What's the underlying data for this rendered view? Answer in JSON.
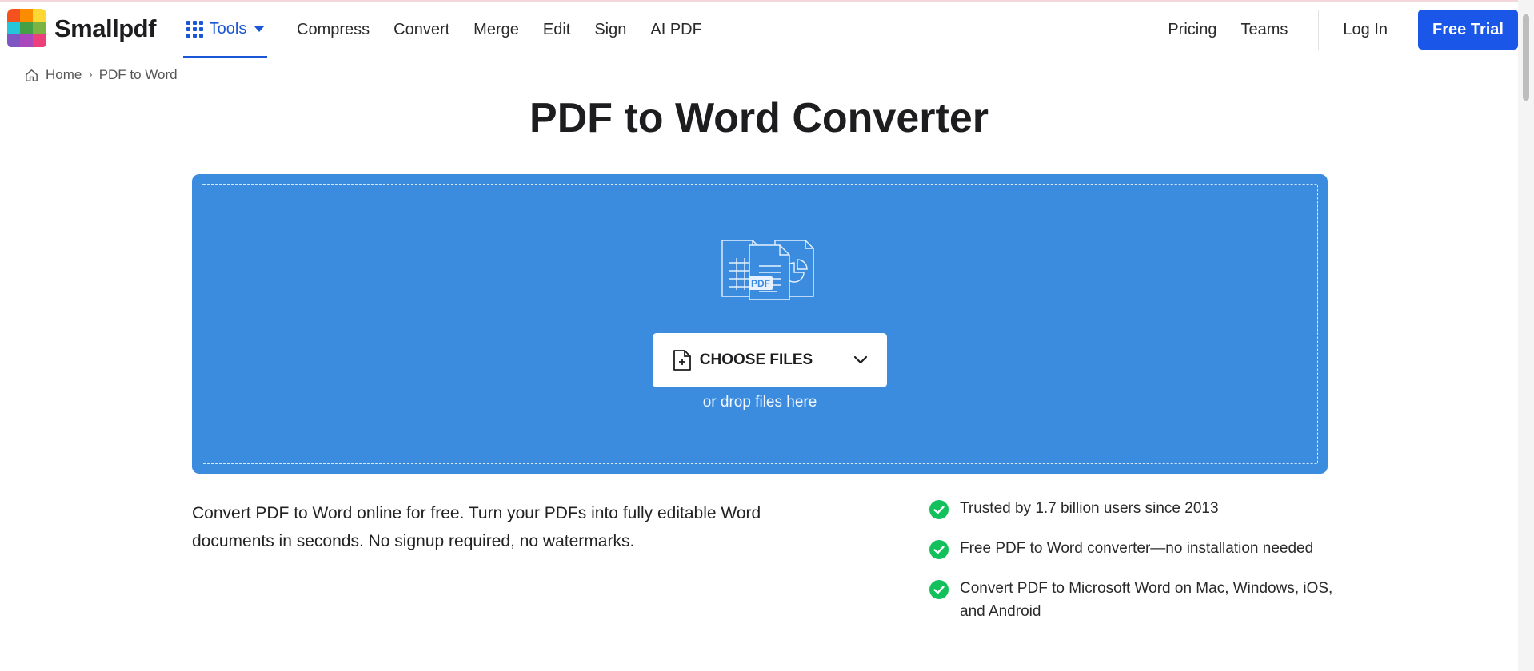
{
  "brand": {
    "name": "Smallpdf",
    "logo_colors": [
      "#f4511e",
      "#fb8c00",
      "#fdd835",
      "#26c6da",
      "#43a047",
      "#7cb342",
      "#7e57c2",
      "#ab47bc",
      "#ec407a"
    ]
  },
  "nav": {
    "tools_label": "Tools",
    "links": [
      "Compress",
      "Convert",
      "Merge",
      "Edit",
      "Sign",
      "AI PDF"
    ],
    "pricing": "Pricing",
    "teams": "Teams",
    "login": "Log In",
    "trial": "Free Trial"
  },
  "breadcrumb": {
    "home": "Home",
    "separator": "›",
    "current": "PDF to Word"
  },
  "page": {
    "title": "PDF to Word Converter"
  },
  "upload": {
    "pdf_badge": "PDF",
    "choose_label": "CHOOSE FILES",
    "drop_hint": "or drop files here"
  },
  "description": "Convert PDF to Word online for free. Turn your PDFs into fully editable Word documents in seconds. No signup required, no watermarks.",
  "features": [
    "Trusted by 1.7 billion users since 2013",
    "Free PDF to Word converter—no installation needed",
    "Convert PDF to Microsoft Word on Mac, Windows, iOS, and Android"
  ],
  "colors": {
    "accent": "#1a57e8",
    "dropzone": "#3b8cdf",
    "check": "#12c15c"
  }
}
